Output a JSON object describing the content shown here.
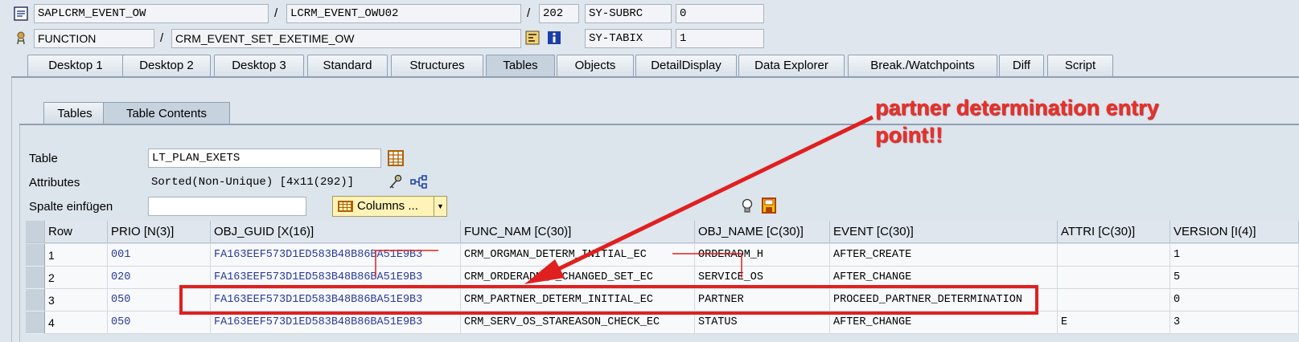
{
  "header": {
    "program": "SAPLCRM_EVENT_OW",
    "include": "LCRM_EVENT_OWU02",
    "line": "202",
    "sy_subrc_label": "SY-SUBRC",
    "sy_subrc_value": "0",
    "type": "FUNCTION",
    "function_name": "CRM_EVENT_SET_EXETIME_OW",
    "sy_tabix_label": "SY-TABIX",
    "sy_tabix_value": "1",
    "separator": "/"
  },
  "main_tabs": [
    "Desktop 1",
    "Desktop 2",
    "Desktop 3",
    "Standard",
    "Structures",
    "Tables",
    "Objects",
    "DetailDisplay",
    "Data Explorer",
    "Break./Watchpoints",
    "Diff",
    "Script"
  ],
  "sub_tabs": [
    "Tables",
    "Table Contents"
  ],
  "form": {
    "table_label": "Table",
    "table_value": "LT_PLAN_EXETS",
    "attributes_label": "Attributes",
    "attributes_value": "Sorted(Non-Unique) [4x11(292)]",
    "spalte_label": "Spalte einfügen",
    "spalte_value": "",
    "columns_button": "Columns ..."
  },
  "table": {
    "headers": [
      "Row",
      "PRIO [N(3)]",
      "OBJ_GUID [X(16)]",
      "FUNC_NAM [C(30)]",
      "OBJ_NAME [C(30)]",
      "EVENT [C(30)]",
      "ATTRI [C(30)]",
      "VERSION [I(4)]"
    ],
    "rows": [
      [
        "1",
        "001",
        "FA163EEF573D1ED583B48B86BA51E9B3",
        "CRM_ORGMAN_DETERM_INITIAL_EC",
        "ORDERADM_H",
        "AFTER_CREATE",
        "",
        "1"
      ],
      [
        "2",
        "020",
        "FA163EEF573D1ED583B48B86BA51E9B3",
        "CRM_ORDERADM_I_CHANGED_SET_EC",
        "SERVICE_OS",
        "AFTER_CHANGE",
        "",
        "5"
      ],
      [
        "3",
        "050",
        "FA163EEF573D1ED583B48B86BA51E9B3",
        "CRM_PARTNER_DETERM_INITIAL_EC",
        "PARTNER",
        "PROCEED_PARTNER_DETERMINATION",
        "",
        "0"
      ],
      [
        "4",
        "050",
        "FA163EEF573D1ED583B48B86BA51E9B3",
        "CRM_SERV_OS_STAREASON_CHECK_EC",
        "STATUS",
        "AFTER_CHANGE",
        "E",
        "3"
      ]
    ]
  },
  "annotation": {
    "line1": "partner determination entry",
    "line2": "point!!",
    "color": "#e8312a"
  }
}
